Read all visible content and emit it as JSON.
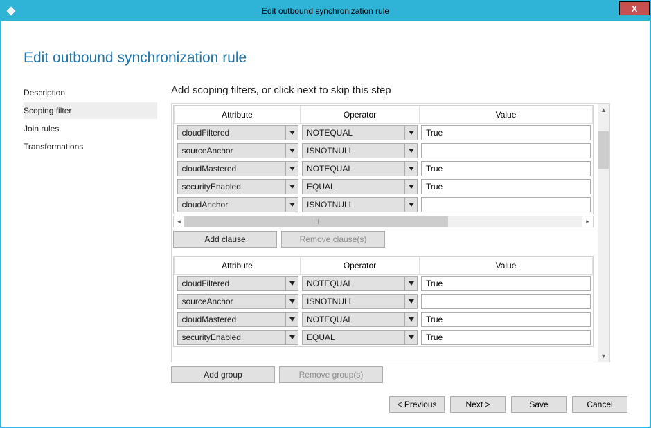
{
  "window": {
    "title": "Edit outbound synchronization rule",
    "close_glyph": "X"
  },
  "page": {
    "title": "Edit outbound synchronization rule",
    "content_header": "Add scoping filters, or click next to skip this step"
  },
  "nav": {
    "items": [
      {
        "label": "Description",
        "active": false
      },
      {
        "label": "Scoping filter",
        "active": true
      },
      {
        "label": "Join rules",
        "active": false
      },
      {
        "label": "Transformations",
        "active": false
      }
    ]
  },
  "columns": {
    "attribute": "Attribute",
    "operator": "Operator",
    "value": "Value"
  },
  "filter_groups": [
    {
      "clauses": [
        {
          "attribute": "cloudFiltered",
          "operator": "NOTEQUAL",
          "value": "True"
        },
        {
          "attribute": "sourceAnchor",
          "operator": "ISNOTNULL",
          "value": ""
        },
        {
          "attribute": "cloudMastered",
          "operator": "NOTEQUAL",
          "value": "True"
        },
        {
          "attribute": "securityEnabled",
          "operator": "EQUAL",
          "value": "True"
        },
        {
          "attribute": "cloudAnchor",
          "operator": "ISNOTNULL",
          "value": ""
        }
      ],
      "has_hscroll": true,
      "has_clause_buttons": true
    },
    {
      "clauses": [
        {
          "attribute": "cloudFiltered",
          "operator": "NOTEQUAL",
          "value": "True"
        },
        {
          "attribute": "sourceAnchor",
          "operator": "ISNOTNULL",
          "value": ""
        },
        {
          "attribute": "cloudMastered",
          "operator": "NOTEQUAL",
          "value": "True"
        },
        {
          "attribute": "securityEnabled",
          "operator": "EQUAL",
          "value": "True"
        }
      ],
      "has_hscroll": false,
      "has_clause_buttons": false
    }
  ],
  "buttons": {
    "add_clause": "Add clause",
    "remove_clauses": "Remove clause(s)",
    "add_group": "Add group",
    "remove_groups": "Remove group(s)",
    "previous": "< Previous",
    "next": "Next >",
    "save": "Save",
    "cancel": "Cancel"
  }
}
